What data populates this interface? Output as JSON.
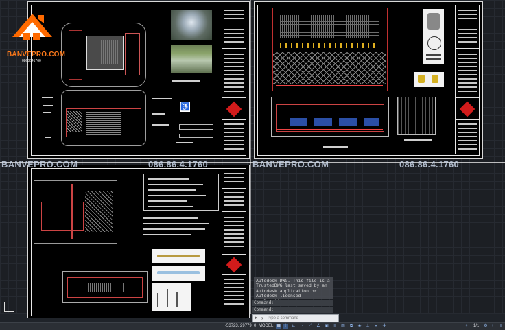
{
  "brand": {
    "logo_name": "BANVEPRO.COM",
    "logo_phone": "0868641760"
  },
  "watermarks": [
    {
      "text": "BANVEPRO.COM"
    },
    {
      "text": "086.86.4.1760"
    },
    {
      "text": "BANVEPRO.COM"
    },
    {
      "text": "086.86.4.1760"
    }
  ],
  "command_window": {
    "message": "Autodesk DWG.  This file is a TrustedDWG last saved by an Autodesk application or Autodesk licensed application.",
    "history": [
      "Command:",
      "Command:"
    ],
    "placeholder": "Type a command"
  },
  "statusbar": {
    "coordinates": "-53723, 29779, 0",
    "space": "MODEL",
    "annotation_scale": "1/1"
  },
  "colors": {
    "background": "#1f2329",
    "sheet": "#000000",
    "accent": "#d21b1b",
    "brand": "#ff7a1a"
  }
}
